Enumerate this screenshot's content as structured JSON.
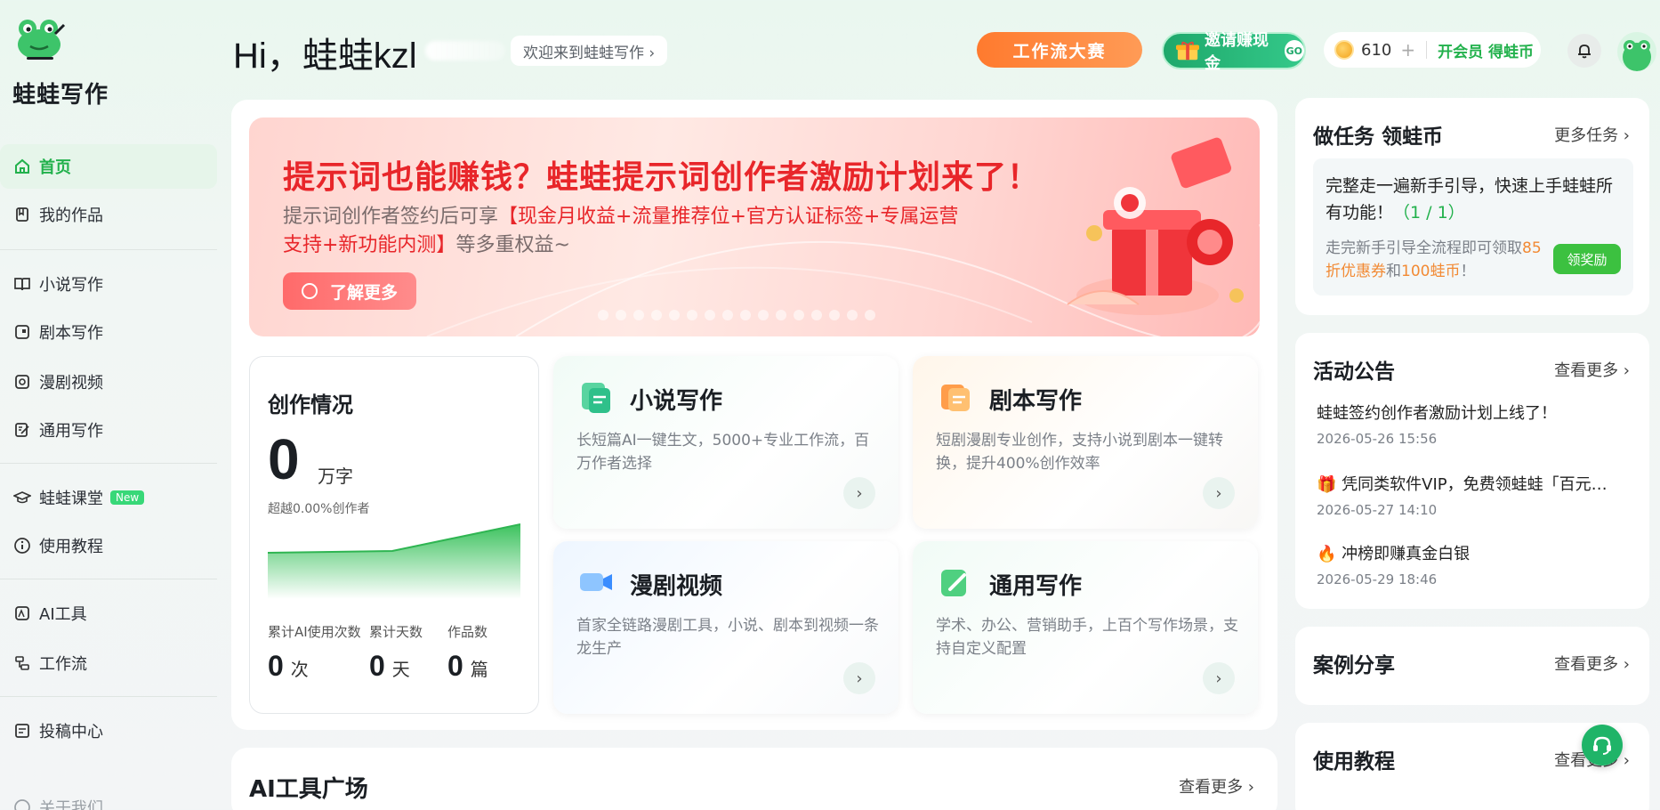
{
  "app": {
    "name": "蛙蛙写作"
  },
  "sidebar": {
    "items": [
      {
        "label": "首页",
        "icon": "home-icon"
      },
      {
        "label": "我的作品",
        "icon": "bookmark-icon"
      },
      {
        "label": "小说写作",
        "icon": "book-icon"
      },
      {
        "label": "剧本写作",
        "icon": "script-icon"
      },
      {
        "label": "漫剧视频",
        "icon": "video-icon"
      },
      {
        "label": "通用写作",
        "icon": "edit-icon"
      },
      {
        "label": "蛙蛙课堂",
        "icon": "graduation-cap-icon",
        "badge": "New"
      },
      {
        "label": "使用教程",
        "icon": "info-icon"
      },
      {
        "label": "AI工具",
        "icon": "ai-tool-icon"
      },
      {
        "label": "工作流",
        "icon": "workflow-icon"
      },
      {
        "label": "投稿中心",
        "icon": "submission-icon"
      },
      {
        "label": "关于我们",
        "icon": "about-icon"
      }
    ]
  },
  "header": {
    "greeting": "Hi，蛙蛙kzl",
    "welcome": "欢迎来到蛙蛙写作 ›",
    "contest_label": "工作流大赛",
    "invite_label": "邀请赚现金",
    "invite_go": "GO",
    "coins": "610",
    "coins_plus": "+",
    "vip_label": "开会员 得蛙币"
  },
  "banner": {
    "title": "提示词也能赚钱？蛙蛙提示词创作者激励计划来了！",
    "desc_prefix": "提示词创作者签约后可享",
    "desc_highlight": "【现金月收益+流量推荐位+官方认证标签+专属运营支持+新功能内测】",
    "desc_suffix": "等多重权益~",
    "button": "了解更多"
  },
  "stats": {
    "title": "创作情况",
    "words": "0",
    "words_unit": "万字",
    "exceed": "超越0.00%创作者",
    "ai_uses_label": "累计AI使用次数",
    "ai_uses": "0",
    "ai_uses_unit": "次",
    "days_label": "累计天数",
    "days": "0",
    "days_unit": "天",
    "works_label": "作品数",
    "works": "0",
    "works_unit": "篇"
  },
  "features": [
    {
      "title": "小说写作",
      "desc": "长短篇AI一键生文，5000+专业工作流，百万作者选择"
    },
    {
      "title": "剧本写作",
      "desc": "短剧漫剧专业创作，支持小说到剧本一键转换，提升400%创作效率"
    },
    {
      "title": "漫剧视频",
      "desc": "首家全链路漫剧工具，小说、剧本到视频一条龙生产"
    },
    {
      "title": "通用写作",
      "desc": "学术、办公、营销助手，上百个写作场景，支持自定义配置"
    }
  ],
  "tools": {
    "title": "AI工具广场",
    "more": "查看更多 ›"
  },
  "tasks": {
    "title": "做任务 领蛙币",
    "more": "更多任务 ›",
    "main": "完整走一遍新手引导，快速上手蛙蛙所有功能！",
    "progress": "（1 / 1）",
    "sub_prefix": "走完新手引导全流程即可领取",
    "sub_discount": "85折优惠券",
    "sub_mid": "和",
    "sub_coins": "100蛙币",
    "sub_suffix": "！",
    "button": "领奖励"
  },
  "announcements": {
    "title": "活动公告",
    "more": "查看更多 ›",
    "items": [
      {
        "title": "蛙蛙签约创作者激励计划上线了！",
        "date": "2026-05-26 15:56"
      },
      {
        "title": "🎁 凭同类软件VIP，免费领蛙蛙「百元护航...",
        "date": "2026-05-27 14:10"
      },
      {
        "title": "🔥 冲榜即赚真金白银",
        "date": "2026-05-29 18:46"
      }
    ]
  },
  "cases": {
    "title": "案例分享",
    "more": "查看更多 ›"
  },
  "tutorial": {
    "title": "使用教程",
    "more": "查看更多 ›"
  },
  "colors": {
    "accent": "#22b14c",
    "banner_red": "#e8262a",
    "orange": "#ff7a2e"
  }
}
